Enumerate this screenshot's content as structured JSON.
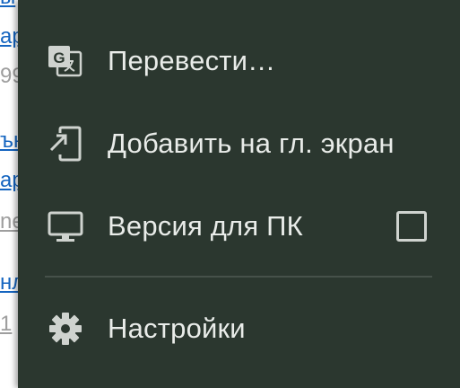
{
  "background_page": {
    "fragments": [
      "ар",
      "99",
      "ън",
      "ар",
      "ne",
      "нл",
      "1"
    ]
  },
  "menu": {
    "items": [
      {
        "label": "Перевести…",
        "icon": "translate-icon"
      },
      {
        "label": "Добавить на гл. экран",
        "icon": "add-to-homescreen-icon"
      },
      {
        "label": "Версия для ПК",
        "icon": "desktop-icon",
        "checkbox_checked": false
      },
      {
        "label": "Настройки",
        "icon": "settings-gear-icon"
      }
    ]
  },
  "colors": {
    "menu_background": "#2b372f",
    "menu_text": "#e9ece9",
    "icon": "#cfd3cf",
    "link": "#1565c0"
  }
}
